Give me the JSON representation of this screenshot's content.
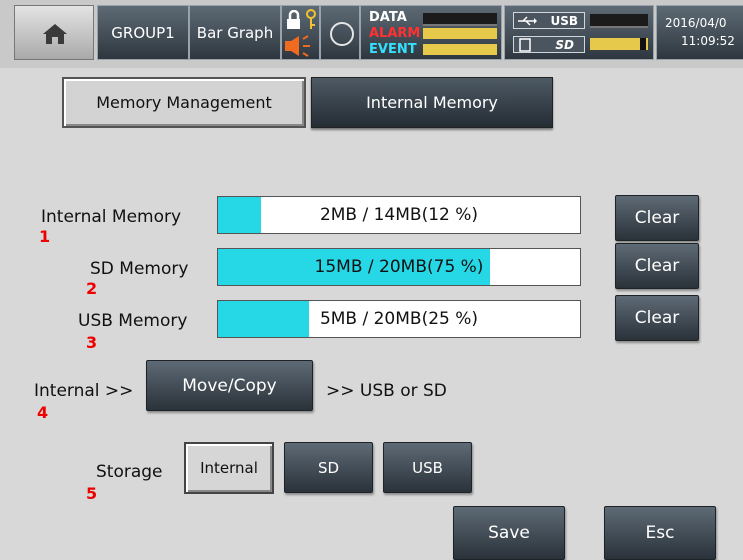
{
  "status_bar": {
    "group": "GROUP1",
    "view": "Bar Graph",
    "indicators": [
      "DATA",
      "ALARM",
      "EVENT"
    ],
    "usb_label": "USB",
    "sd_label": "SD",
    "date": "2016/04/0",
    "time": "11:09:52",
    "icons": [
      "home-icon",
      "lock-icon",
      "key-icon",
      "speaker-icon",
      "ring-icon",
      "usb-icon",
      "sd-card-icon"
    ]
  },
  "tabs": [
    {
      "label": "Memory Management",
      "active": true
    },
    {
      "label": "Internal Memory",
      "active": false
    }
  ],
  "memory": [
    {
      "label": "Internal Memory",
      "number": "1",
      "usage_text": "2MB / 14MB(12 %)",
      "percent": 12,
      "clear_label": "Clear"
    },
    {
      "label": "SD Memory",
      "number": "2",
      "usage_text": "15MB / 20MB(75 %)",
      "percent": 75,
      "clear_label": "Clear"
    },
    {
      "label": "USB Memory",
      "number": "3",
      "usage_text": "5MB / 20MB(25 %)",
      "percent": 25,
      "clear_label": "Clear"
    }
  ],
  "move": {
    "prefix": "Internal >>",
    "button_label": "Move/Copy",
    "suffix": ">> USB or SD",
    "number": "4"
  },
  "storage": {
    "label": "Storage",
    "number": "5",
    "options": [
      "Internal",
      "SD",
      "USB"
    ],
    "selected": "Internal"
  },
  "footer": {
    "save_label": "Save",
    "esc_label": "Esc"
  },
  "colors": {
    "progress_fill": "#26d8e6",
    "annotation_red": "#e00000",
    "button_dark": "#3a444e",
    "alarm_red": "#ff3232",
    "event_cyan": "#35e0ff"
  }
}
